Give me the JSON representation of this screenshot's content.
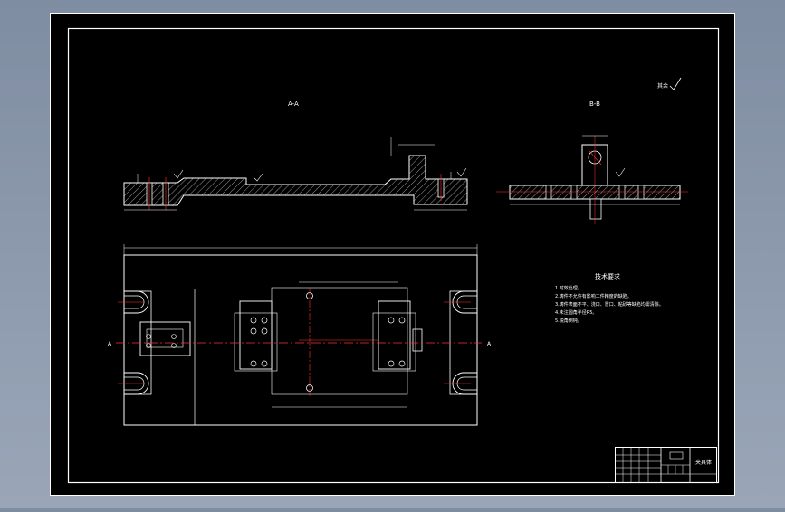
{
  "drawing": {
    "colors": {
      "background": "#000000",
      "line": "#ffffff",
      "center_line": "#ff3030",
      "hatch": "#ffffff"
    },
    "roughness_note": "其余",
    "section_aa": {
      "label": "A-A"
    },
    "section_bb": {
      "label": "B-B"
    },
    "plan_view": {
      "cut_marker_left": "A",
      "cut_marker_right": "A"
    },
    "technical_requirements": {
      "title": "技术要求",
      "items": [
        "1.时效处理。",
        "2.铸件不允许有影响工件精度的缺陷。",
        "3.铸件表面不平、浇口、冒口、粘砂等缺陷均需清除。",
        "4.未注圆角半径R5。",
        "5.锐角倒钝。"
      ]
    },
    "title_block": {
      "part_name": "夹具体"
    }
  }
}
